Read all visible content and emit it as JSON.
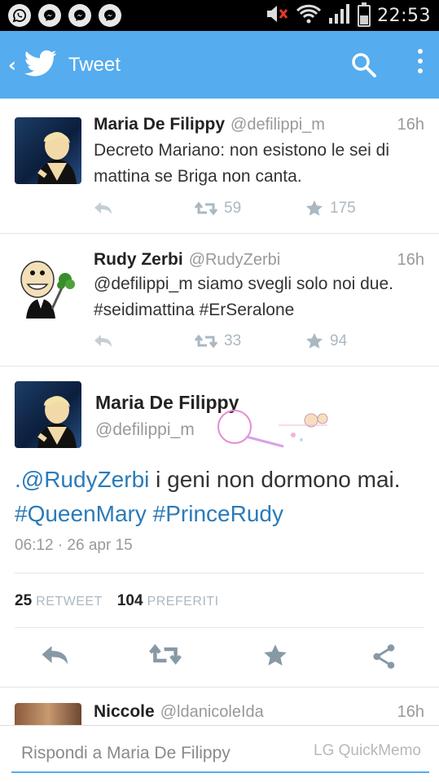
{
  "status_bar": {
    "time": "22:53",
    "notification_icons": [
      "whatsapp-icon",
      "messenger-icon",
      "messenger-icon",
      "messenger-icon"
    ],
    "system_icons": [
      "volume-muted-icon",
      "wifi-icon",
      "signal-icon",
      "battery-icon"
    ],
    "battery_level": 0.45
  },
  "app_bar": {
    "title": "Tweet",
    "color": "#55acee"
  },
  "tweets": [
    {
      "name": "Maria De Filippy",
      "handle": "@defilippi_m",
      "time": "16h",
      "text": "Decreto Mariano: non esistono le sei di mattina se Briga non canta.",
      "retweets": "59",
      "favorites": "175"
    },
    {
      "name": "Rudy Zerbi",
      "handle": "@RudyZerbi",
      "time": "16h",
      "text": "@defilippi_m siamo svegli solo noi due. #seidimattina #ErSeralone",
      "retweets": "33",
      "favorites": "94"
    }
  ],
  "detail": {
    "name": "Maria De Filippy",
    "handle": "@defilippi_m",
    "text_prefix": ".",
    "mention": "@RudyZerbi",
    "text_body": " i geni non dormono mai.",
    "hashtag1": "#QueenMary",
    "hashtag2": "#PrinceRudy",
    "date": "06:12 · 26 apr 15",
    "retweet_count": "25",
    "retweet_label": "RETWEET",
    "favorite_count": "104",
    "favorite_label": "PREFERITI"
  },
  "next_tweet": {
    "name": "Niccole",
    "handle": "@ldanicoleIda",
    "time": "16h"
  },
  "reply_bar": {
    "placeholder": "Rispondi a Maria De Filippy",
    "watermark": "LG QuickMemo"
  }
}
